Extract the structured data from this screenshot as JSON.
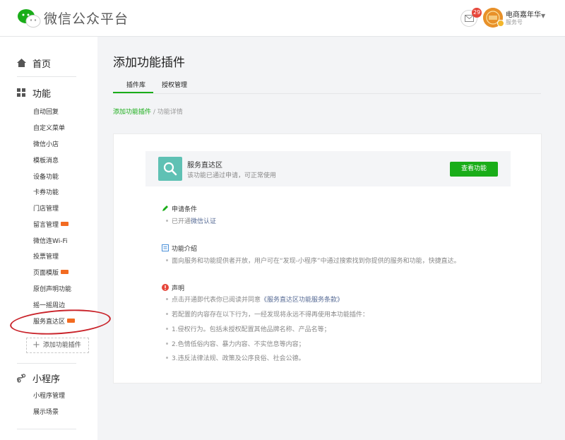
{
  "header": {
    "brand": "微信公众平台",
    "mail_count": "29",
    "account_name": "电商嘉年华",
    "account_type": "服务号"
  },
  "sidebar": {
    "sections": [
      {
        "label": "首页",
        "icon": "home-icon"
      },
      {
        "label": "功能",
        "icon": "grid-icon"
      },
      {
        "label": "小程序",
        "icon": "mini-program-icon"
      }
    ],
    "function_items": [
      {
        "label": "自动回复",
        "new": false
      },
      {
        "label": "自定义菜单",
        "new": false
      },
      {
        "label": "微信小店",
        "new": false
      },
      {
        "label": "模板消息",
        "new": false
      },
      {
        "label": "设备功能",
        "new": false
      },
      {
        "label": "卡券功能",
        "new": false
      },
      {
        "label": "门店管理",
        "new": false
      },
      {
        "label": "留言管理",
        "new": true
      },
      {
        "label": "微信连Wi-Fi",
        "new": false
      },
      {
        "label": "投票管理",
        "new": false
      },
      {
        "label": "页面模版",
        "new": true
      },
      {
        "label": "原创声明功能",
        "new": false
      },
      {
        "label": "摇一摇周边",
        "new": false
      },
      {
        "label": "服务直达区",
        "new": true
      }
    ],
    "add_plugin": "添加功能插件",
    "mini_items": [
      {
        "label": "小程序管理"
      },
      {
        "label": "展示场景"
      }
    ]
  },
  "main": {
    "title": "添加功能插件",
    "tabs": [
      "插件库",
      "授权管理"
    ],
    "breadcrumb": {
      "link": "添加功能插件",
      "separator": " / ",
      "current": "功能详情"
    },
    "service": {
      "name": "服务直达区",
      "desc": "该功能已通过申请，可正常使用",
      "button": "查看功能"
    },
    "conditions": {
      "title": "申请条件",
      "item_prefix": "已开通",
      "item_link": "微信认证"
    },
    "intro": {
      "title": "功能介绍",
      "text": "面向服务和功能提供者开放，用户可在“发现-小程序”中通过搜索找到你提供的服务和功能，快捷直达。"
    },
    "statement": {
      "title": "声明",
      "line1_prefix": "点击开通即代表你已阅读并同意",
      "line1_link": "《服务直达区功能服务条款》",
      "line2": "若配置的内容存在以下行为，一经发现将永远不得再使用本功能插件：",
      "line3": "1.侵权行为。包括未授权配置其他品牌名称、产品名等；",
      "line4": "2.色情低俗内容、暴力内容、不实信息等内容；",
      "line5": "3.违反法律法规、政策及公序良俗、社会公德。"
    }
  },
  "colors": {
    "accent": "#1aad19",
    "badge_red": "#e6463a",
    "new_badge": "#f26b21",
    "link": "#576b95",
    "tile": "#5fc1b4",
    "highlight_circle": "#c9232a"
  }
}
